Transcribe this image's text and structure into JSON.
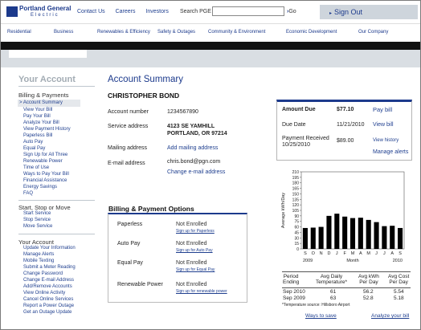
{
  "header": {
    "logo_line1": "Portland General",
    "logo_line2": "Electric",
    "links": [
      "Contact Us",
      "Careers",
      "Investors"
    ],
    "search_label": "Search PGE",
    "search_placeholder": "",
    "go_label": "Go",
    "signout_label": "Sign Out"
  },
  "nav": [
    "Residential",
    "Business",
    "Renewables & Efficiency",
    "Safety & Outages",
    "Community & Environment",
    "Economic Development",
    "Our Company"
  ],
  "sidebar": {
    "title": "Your Account",
    "billing_heading": "Billing & Payments",
    "billing_items": [
      "> Account Summary",
      "View Your Bill",
      "Pay Your Bill",
      "Analyze Your Bill",
      "View Payment History",
      "Paperless Bill",
      "Auto Pay",
      "Equal Pay",
      "Sign Up for All Three",
      "Renewable Power",
      "Time of Use",
      "Ways to Pay Your Bill",
      "Financial Assistance",
      "Energy Savings",
      "FAQ"
    ],
    "service_heading": "Start, Stop or Move",
    "service_items": [
      "Start Service",
      "Stop Service",
      "Move Service"
    ],
    "account_heading": "Your Account",
    "account_items": [
      "Update Your Information",
      "Manage Alerts",
      "Mobile Texting",
      "Submit a Meter Reading",
      "Change Password",
      "Change E-mail Address",
      "Add/Remove Accounts",
      "View Online Activity",
      "Cancel Online Services",
      "Report a Power Outage",
      "Get an Outage Update"
    ]
  },
  "summary": {
    "title": "Account Summary",
    "customer_name": "CHRISTOPHER BOND",
    "account_number_label": "Account number",
    "account_number": "1234567890",
    "service_address_label": "Service address",
    "service_address_1": "4123 SE YAMHILL",
    "service_address_2": "PORTLAND, OR 97214",
    "mailing_address_label": "Mailing address",
    "mailing_address_link": "Add mailing address",
    "email_label": "E-mail address",
    "email": "chris.bond@pgn.com",
    "email_change_link": "Change e-mail address"
  },
  "billing_options": {
    "title": "Billing & Payment Options",
    "rows": [
      {
        "label": "Paperless",
        "status": "Not Enrolled",
        "signup": "Sign up for Paperless"
      },
      {
        "label": "Auto Pay",
        "status": "Not Enrolled",
        "signup": "Sign up for Auto Pay"
      },
      {
        "label": "Equal Pay",
        "status": "Not Enrolled",
        "signup": "Sign up for Equal Pay"
      },
      {
        "label": "Renewable Power",
        "status": "Not Enrolled",
        "signup": "Sign up for renewable power"
      }
    ]
  },
  "amount": {
    "amount_due_label": "Amount Due",
    "amount_due": "$77.10",
    "pay_bill_link": "Pay bill",
    "due_date_label": "Due Date",
    "due_date": "11/21/2010",
    "view_bill_link": "View bill",
    "payment_label_1": "Payment Received",
    "payment_label_2": "10/25/2010",
    "payment_amount": "$89.00",
    "view_history_link": "View history",
    "manage_alerts_link": "Manage alerts"
  },
  "chart_data": {
    "type": "bar",
    "ylabel": "Average kWh/Day",
    "xlabel": "Month",
    "x_start_label": "2009",
    "x_end_label": "2010",
    "categories": [
      "S",
      "O",
      "N",
      "D",
      "J",
      "F",
      "M",
      "A",
      "M",
      "J",
      "J",
      "A",
      "S"
    ],
    "values": [
      57,
      58,
      60,
      90,
      96,
      88,
      84,
      85,
      79,
      73,
      62,
      63,
      57
    ],
    "ylim": [
      0,
      210
    ],
    "yticks": [
      0,
      15,
      30,
      45,
      60,
      75,
      90,
      105,
      120,
      135,
      150,
      165,
      180,
      195,
      210
    ],
    "grid": false,
    "bar_color": "#000000"
  },
  "comparison": {
    "headers": [
      [
        "Period",
        "Ending"
      ],
      [
        "Avg Daily",
        "Temperature*"
      ],
      [
        "Avg kWh",
        "Per Day"
      ],
      [
        "Avg Cost",
        "Per Day"
      ]
    ],
    "rows": [
      [
        "Sep 2010",
        "61",
        "56.2",
        "5.54"
      ],
      [
        "Sep 2009",
        "63",
        "52.8",
        "5.18"
      ]
    ],
    "note": "*Temperature source: Hillsboro Airport",
    "links": [
      "Ways to save",
      "Analyze your bill"
    ]
  },
  "colors": {
    "brand": "#1c3a8c",
    "link": "#1f3f8f",
    "sidebar_title": "#a3acb4",
    "dark_bar": "#111111"
  }
}
